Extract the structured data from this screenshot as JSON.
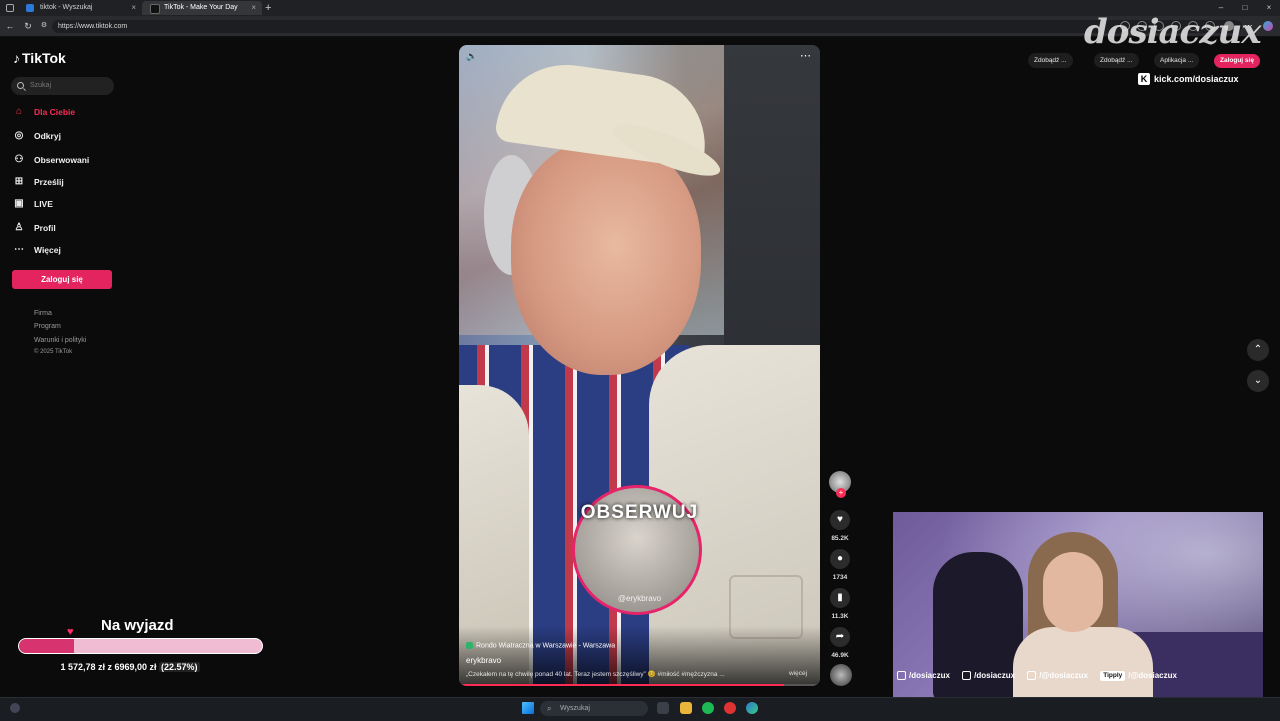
{
  "browser": {
    "tabs": [
      {
        "label": "tiktok - Wyszukaj"
      },
      {
        "label": "TikTok - Make Your Day"
      }
    ],
    "new_tab": "+",
    "url": "https://www.tiktok.com",
    "window_controls": {
      "min": "–",
      "max": "□",
      "close": "×"
    }
  },
  "sidebar": {
    "logo": "TikTok",
    "search_placeholder": "Szukaj",
    "items": [
      {
        "label": "Dla Ciebie",
        "icon": "home-icon",
        "active": true
      },
      {
        "label": "Odkryj",
        "icon": "compass-icon"
      },
      {
        "label": "Obserwowani",
        "icon": "user-follow-icon"
      },
      {
        "label": "Prześlij",
        "icon": "upload-icon"
      },
      {
        "label": "LIVE",
        "icon": "live-icon"
      },
      {
        "label": "Profil",
        "icon": "profile-icon"
      },
      {
        "label": "Więcej",
        "icon": "more-icon"
      }
    ],
    "login_button": "Zaloguj się",
    "footer": [
      "Firma",
      "Program",
      "Warunki i polityki",
      "© 2025 TikTok"
    ]
  },
  "video": {
    "overlay_text": "OBSERWUJ",
    "overlay_handle": "@erykbravo",
    "location": "Rondo Wiatraczna w Warszawie - Warszawa",
    "author": "erykbravo",
    "caption": "„Czekałem na tę chwilę ponad 40 lat. Teraz jestem szczęśliwy” 😊 #miłość #mężczyzna ...",
    "more": "więcej",
    "progress_fraction": 0.9
  },
  "actions": {
    "likes": "85.2K",
    "comments": "1734",
    "saves": "11.3K",
    "shares": "46.9K"
  },
  "topbar": {
    "get_app": "Zdobądź ...",
    "get_coins": "Zdobądź ...",
    "app": "Aplikacja ...",
    "login": "Zaloguj się"
  },
  "stream_overlay": {
    "brand": "dosiaczux",
    "kick": "kick.com/dosiaczux",
    "goal": {
      "title": "Na wyjazd",
      "text": "1 572,78 zł z 6969,00 zł",
      "percent": "(22.57%)",
      "fraction": 0.2257
    },
    "socials": [
      {
        "label": "/dosiaczux"
      },
      {
        "label": "/dosiaczux"
      },
      {
        "label": "/@dosiaczux"
      },
      {
        "label": "/@dosiaczux",
        "tag": "Tipply"
      }
    ]
  },
  "taskbar": {
    "search_placeholder": "Wyszukaj"
  },
  "colors": {
    "accent": "#fe2c55",
    "login": "#e3245f",
    "goal_fill": "#d6336f",
    "goal_bg": "#f0bcd3"
  }
}
